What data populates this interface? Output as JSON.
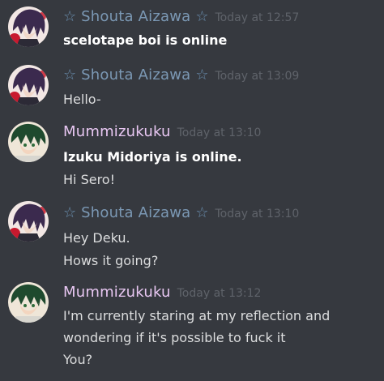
{
  "colors": {
    "background": "#36393f",
    "aizawa_name": "#7b98b4",
    "midoriya_name": "#e8c7f2",
    "timestamp": "#5f636a",
    "message_text": "#dcddde"
  },
  "messages": [
    {
      "author": "Shouta Aizawa",
      "star_left": "☆",
      "star_right": "☆",
      "timestamp": "Today at 12:57",
      "avatar_icon": "aizawa-avatar-icon",
      "lines": [
        "scelotape boi is online"
      ]
    },
    {
      "author": "Shouta Aizawa",
      "star_left": "☆",
      "star_right": "☆",
      "timestamp": "Today at 13:09",
      "avatar_icon": "aizawa-avatar-icon",
      "lines": [
        "Hello-"
      ]
    },
    {
      "author": "Mummizukuku",
      "timestamp": "Today at 13:10",
      "avatar_icon": "midoriya-avatar-icon",
      "lines": [
        "Izuku Midoriya is online.",
        "Hi Sero!"
      ]
    },
    {
      "author": "Shouta Aizawa",
      "star_left": "☆",
      "star_right": "☆",
      "timestamp": "Today at 13:10",
      "avatar_icon": "aizawa-avatar-icon",
      "lines": [
        "Hey Deku.",
        "Hows it going?"
      ]
    },
    {
      "author": "Mummizukuku",
      "timestamp": "Today at 13:12",
      "avatar_icon": "midoriya-avatar-icon",
      "lines": [
        "I'm currently staring at my reflection and",
        "wondering if it's possible to fuck it",
        "You?"
      ]
    }
  ]
}
